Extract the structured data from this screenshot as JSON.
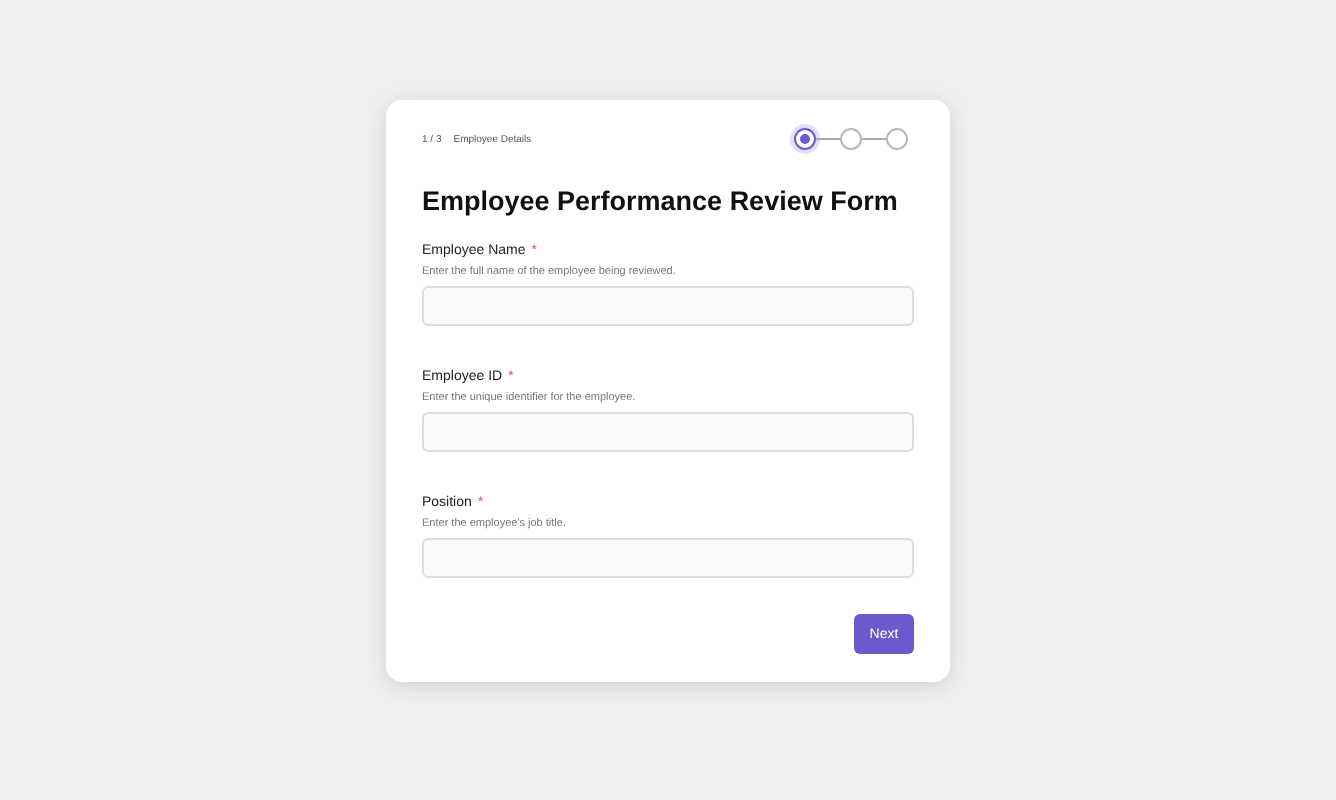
{
  "progress": {
    "counter": "1 / 3",
    "step_title": "Employee Details"
  },
  "steps": [
    {
      "selected": true
    },
    {
      "selected": false
    },
    {
      "selected": false
    }
  ],
  "title": "Employee Performance Review Form",
  "fields": [
    {
      "label": "Employee Name",
      "required": true,
      "required_mark": "*",
      "hint": "Enter the full name of the employee being reviewed."
    },
    {
      "label": "Employee ID",
      "required": true,
      "required_mark": "*",
      "hint": "Enter the unique identifier for the employee."
    },
    {
      "label": "Position",
      "required": true,
      "required_mark": "*",
      "hint": "Enter the employee's job title."
    }
  ],
  "next_button": "Next"
}
